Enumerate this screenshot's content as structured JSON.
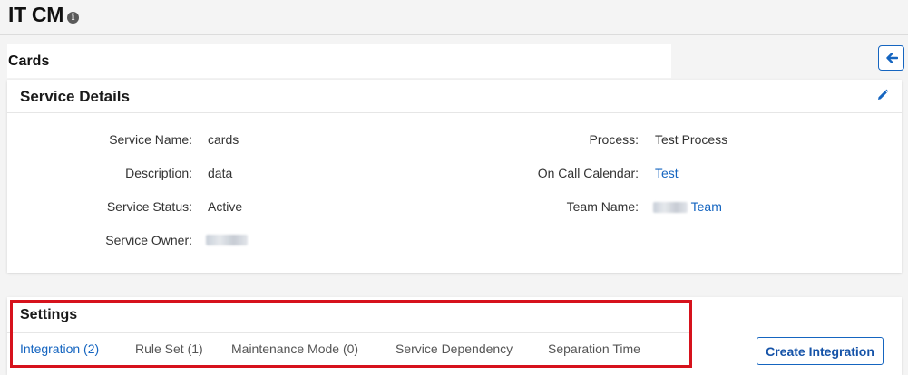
{
  "app": {
    "title": "IT CM",
    "info_icon": "info-icon"
  },
  "service": {
    "name_title": "Cards",
    "back_icon": "arrow-left-icon"
  },
  "details": {
    "title": "Service Details",
    "edit_icon": "pencil-icon",
    "left_fields": [
      {
        "label": "Service Name:",
        "value": "cards"
      },
      {
        "label": "Description:",
        "value": "data"
      },
      {
        "label": "Service Status:",
        "value": "Active"
      },
      {
        "label": "Service Owner:",
        "value": ""
      }
    ],
    "right_fields": [
      {
        "label": "Process:",
        "value": "Test Process"
      },
      {
        "label": "On Call Calendar:",
        "value": "Test"
      },
      {
        "label": "Team Name:",
        "value": "Team"
      }
    ]
  },
  "settings": {
    "title": "Settings",
    "tabs": [
      {
        "label": "Integration (2)",
        "active": true
      },
      {
        "label": "Rule Set (1)",
        "active": false
      },
      {
        "label": "Maintenance Mode (0)",
        "active": false
      },
      {
        "label": "Service Dependency",
        "active": false
      },
      {
        "label": "Separation Time",
        "active": false
      }
    ],
    "create_button_label": "Create Integration"
  },
  "colors": {
    "accent": "#1565c0",
    "highlight": "#d6121c",
    "background": "#f4f4f4"
  }
}
